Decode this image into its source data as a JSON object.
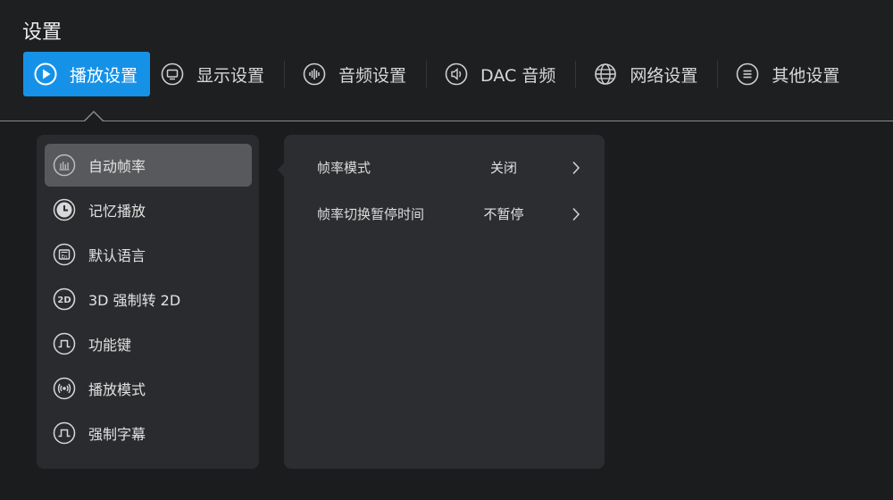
{
  "header": {
    "title": "设置"
  },
  "tabs": [
    {
      "label": "播放设置",
      "icon": "play-circle-icon",
      "active": true
    },
    {
      "label": "显示设置",
      "icon": "monitor-icon"
    },
    {
      "label": "音频设置",
      "icon": "audio-wave-icon"
    },
    {
      "label": "DAC 音频",
      "icon": "speaker-icon"
    },
    {
      "label": "网络设置",
      "icon": "globe-icon"
    },
    {
      "label": "其他设置",
      "icon": "menu-lines-icon"
    }
  ],
  "menu": {
    "items": [
      {
        "label": "自动帧率",
        "icon": "frame-rate-icon",
        "selected": true
      },
      {
        "label": "记忆播放",
        "icon": "clock-icon"
      },
      {
        "label": "默认语言",
        "icon": "language-icon"
      },
      {
        "label": "3D 强制转 2D",
        "icon": "2d-icon"
      },
      {
        "label": "功能键",
        "icon": "pulse-icon"
      },
      {
        "label": "播放模式",
        "icon": "broadcast-icon"
      },
      {
        "label": "强制字幕",
        "icon": "pulse-icon"
      }
    ]
  },
  "options": [
    {
      "label": "帧率模式",
      "value": "关闭"
    },
    {
      "label": "帧率切换暂停时间",
      "value": "不暂停"
    }
  ],
  "colors": {
    "accent": "#1592e8",
    "background": "#1b1c1e",
    "panel": "#2a2b2e",
    "selected": "#58595c"
  }
}
